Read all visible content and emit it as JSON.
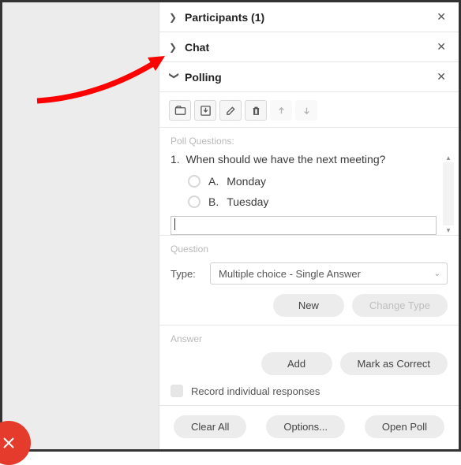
{
  "panels": {
    "participants": {
      "title": "Participants (1)",
      "expanded": false
    },
    "chat": {
      "title": "Chat",
      "expanded": false
    },
    "polling": {
      "title": "Polling",
      "expanded": true
    }
  },
  "poll": {
    "questions_label": "Poll Questions:",
    "question": {
      "number": "1.",
      "text": "When should we have the next meeting?"
    },
    "options": [
      {
        "letter": "A.",
        "text": "Monday"
      },
      {
        "letter": "B.",
        "text": "Tuesday"
      }
    ],
    "new_option_value": ""
  },
  "question_section": {
    "label": "Question",
    "type_label": "Type:",
    "type_value": "Multiple choice - Single Answer",
    "buttons": {
      "new": "New",
      "change_type": "Change Type"
    }
  },
  "answer_section": {
    "label": "Answer",
    "buttons": {
      "add": "Add",
      "mark_correct": "Mark as Correct"
    },
    "record_label": "Record individual responses"
  },
  "footer": {
    "clear_all": "Clear All",
    "options": "Options...",
    "open_poll": "Open Poll"
  },
  "icons": {
    "open": "open-icon",
    "save": "save-icon",
    "edit": "edit-icon",
    "delete": "delete-icon",
    "up": "up-icon",
    "down": "down-icon"
  }
}
